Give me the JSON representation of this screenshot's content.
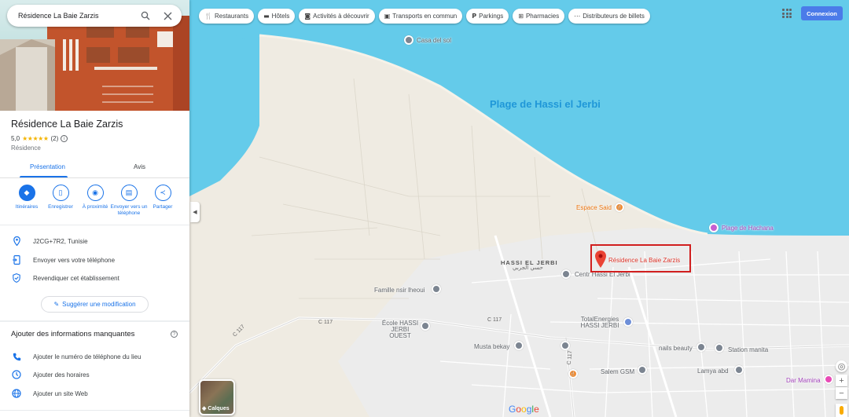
{
  "search": {
    "value": "Résidence La Baie Zarzis",
    "icon": "search-icon",
    "close_icon": "close-icon"
  },
  "place": {
    "title": "Résidence La Baie Zarzis",
    "rating": "5,0",
    "stars": "★★★★★",
    "reviews": "(2)",
    "category": "Résidence"
  },
  "tabs": [
    {
      "label": "Présentation",
      "active": true
    },
    {
      "label": "Avis",
      "active": false
    }
  ],
  "actions": [
    {
      "label": "Itinéraires",
      "icon": "directions-icon"
    },
    {
      "label": "Enregistrer",
      "icon": "bookmark-icon"
    },
    {
      "label": "À proximité",
      "icon": "nearby-icon"
    },
    {
      "label": "Envoyer vers un téléphone",
      "icon": "send-to-phone-icon"
    },
    {
      "label": "Partager",
      "icon": "share-icon"
    }
  ],
  "details": [
    {
      "text": "J2CG+7R2, Tunisie",
      "icon": "location-pin-icon"
    },
    {
      "text": "Envoyer vers votre téléphone",
      "icon": "phone-send-icon"
    },
    {
      "text": "Revendiquer cet établissement",
      "icon": "shield-check-icon"
    }
  ],
  "suggest_label": "Suggérer une modification",
  "missing": {
    "title": "Ajouter des informations manquantes",
    "items": [
      {
        "text": "Ajouter le numéro de téléphone du lieu",
        "icon": "phone-icon"
      },
      {
        "text": "Ajouter des horaires",
        "icon": "clock-icon"
      },
      {
        "text": "Ajouter un site Web",
        "icon": "globe-icon"
      }
    ]
  },
  "chips": [
    {
      "label": "Restaurants",
      "icon": "fork-knife-icon"
    },
    {
      "label": "Hôtels",
      "icon": "bed-icon"
    },
    {
      "label": "Activités à découvrir",
      "icon": "camera-icon"
    },
    {
      "label": "Transports en commun",
      "icon": "bus-icon"
    },
    {
      "label": "Parkings",
      "icon": "parking-icon"
    },
    {
      "label": "Pharmacies",
      "icon": "pharmacy-icon"
    },
    {
      "label": "Distributeurs de billets",
      "icon": "atm-icon"
    }
  ],
  "connexion_label": "Connexion",
  "map": {
    "beach_label": "Plage de Hassi el Jerbi",
    "area_label": "HASSI EL JERBI",
    "area_label_ar": "حسي الجربي",
    "places": {
      "espace_said": "Espace Said",
      "plage_hachana": "Plage de Hachana",
      "target": "Résidence La Baie Zarzis",
      "centr": "Centr Hassi El Jerbi",
      "famille": "Famille nsir lheoui",
      "ecole": "École HASSI JERBI OUEST",
      "total": "TotalEnergies HASSI JERBI",
      "musta": "Musta bekay",
      "nails": "nails beauty",
      "station": "Station manita",
      "salem": "Salem GSM",
      "lamya": "Lamya abd",
      "dar_mamina": "Dar Mamina",
      "top_place": "Casa del sol"
    },
    "roads": [
      "C 117",
      "C 117",
      "C 117",
      "C 117"
    ],
    "layers_label": "Calques",
    "google": "Google"
  },
  "colors": {
    "accent": "#1a73e8",
    "water": "#5ecbec",
    "land": "#f1ede4",
    "target_box": "#d11f1f"
  }
}
